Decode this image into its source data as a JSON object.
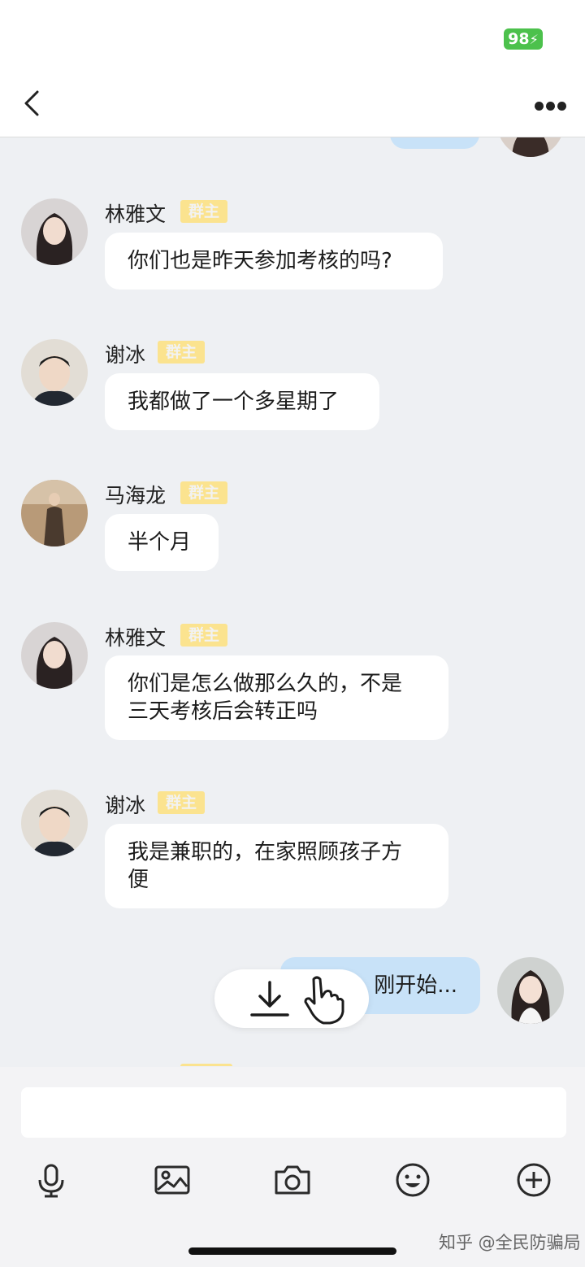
{
  "status": {
    "battery": "98"
  },
  "header": {
    "back_icon": "chevron-left-icon",
    "more_icon": "more-dots-icon"
  },
  "messages": [
    {
      "sender": "林雅文",
      "badge": "群主",
      "text": "你们也是昨天参加考核的吗?"
    },
    {
      "sender": "谢冰",
      "badge": "群主",
      "text": "我都做了一个多星期了"
    },
    {
      "sender": "马海龙",
      "badge": "群主",
      "text": "半个月"
    },
    {
      "sender": "林雅文",
      "badge": "群主",
      "lines": [
        "你们是怎么做那么久的，不是",
        "三天考核后会转正吗"
      ]
    },
    {
      "sender": "谢冰",
      "badge": "群主",
      "lines": [
        "我是兼职的，在家照顾孩子方",
        "便"
      ]
    }
  ],
  "my_message": {
    "text": "刚开始..."
  },
  "floating": {
    "download_icon": "download-icon",
    "hand_icon": "pointing-hand-icon"
  },
  "composer": {
    "placeholder": "",
    "tools": [
      "microphone-icon",
      "image-icon",
      "camera-icon",
      "emoji-icon",
      "plus-circle-icon"
    ]
  },
  "watermark": "知乎 @全民防骗局"
}
